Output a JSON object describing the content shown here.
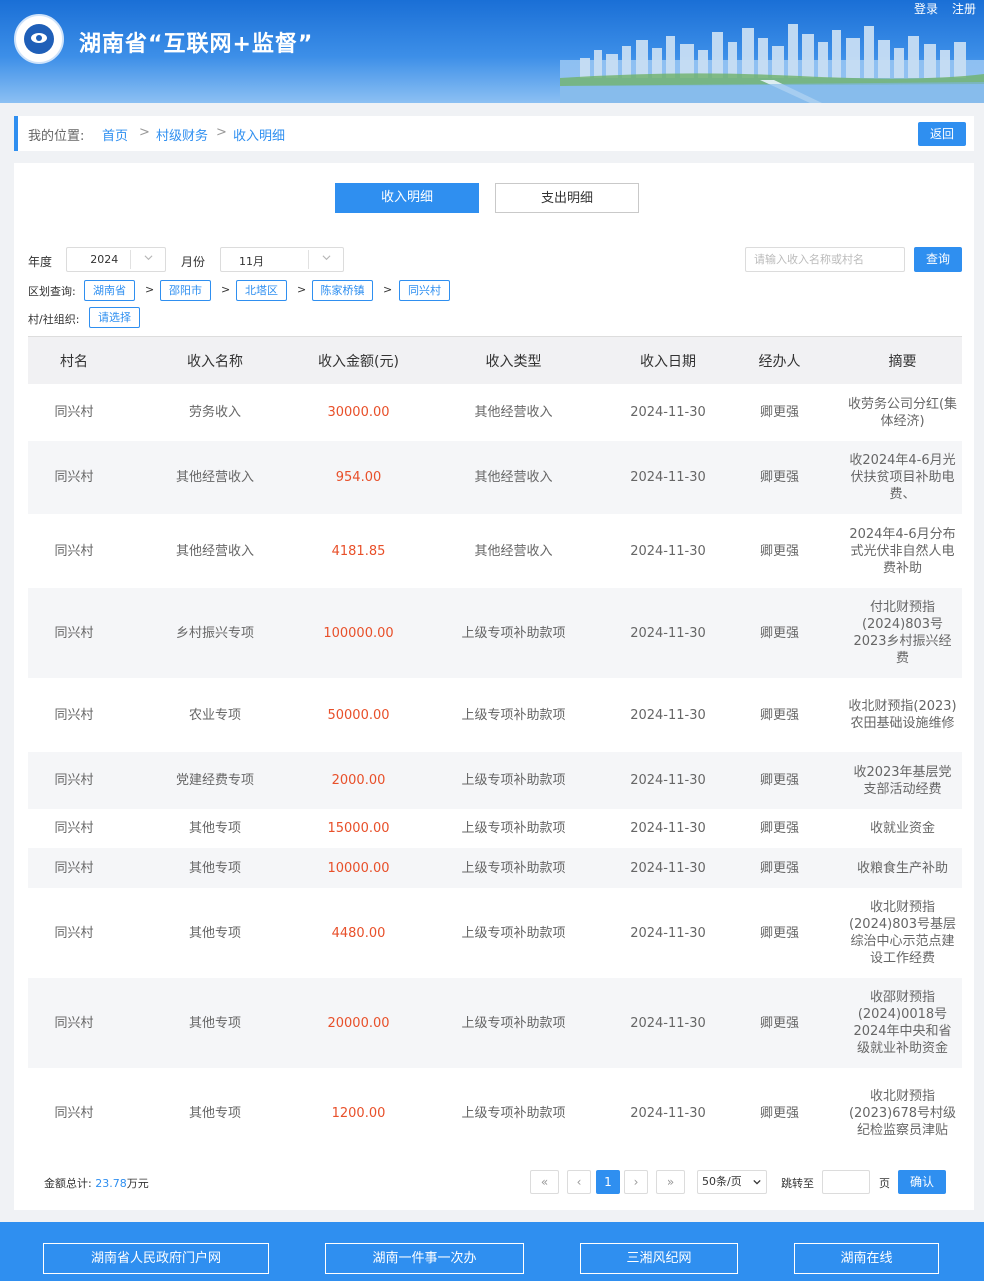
{
  "header": {
    "title": "湖南省“互联网+监督”",
    "login": "登录",
    "register": "注册"
  },
  "breadcrumb": {
    "prefix": "我的位置:",
    "items": [
      "首页",
      "村级财务",
      "收入明细"
    ],
    "separator": ">",
    "back": "返回"
  },
  "tabs": [
    "收入明细",
    "支出明细"
  ],
  "filters": {
    "year_label": "年度",
    "year_value": "2024",
    "month_label": "月份",
    "month_value": "11月",
    "search_placeholder": "请输入收入名称或村名",
    "query_label": "查询",
    "region_label": "区划查询:",
    "regions": [
      "湖南省",
      "邵阳市",
      "北塔区",
      "陈家桥镇",
      "同兴村"
    ],
    "village_label": "村/社组织:",
    "village_select": "请选择"
  },
  "table": {
    "headers": [
      "村名",
      "收入名称",
      "收入金额(元)",
      "收入类型",
      "收入日期",
      "经办人",
      "摘要"
    ],
    "rows": [
      [
        "同兴村",
        "劳务收入",
        "30000.00",
        "其他经营收入",
        "2024-11-30",
        "卿更强",
        "收劳务公司分红(集体经济)"
      ],
      [
        "同兴村",
        "其他经营收入",
        "954.00",
        "其他经营收入",
        "2024-11-30",
        "卿更强",
        "收2024年4-6月光伏扶贫项目补助电费、"
      ],
      [
        "同兴村",
        "其他经营收入",
        "4181.85",
        "其他经营收入",
        "2024-11-30",
        "卿更强",
        "2024年4-6月分布式光伏非自然人电费补助"
      ],
      [
        "同兴村",
        "乡村振兴专项",
        "100000.00",
        "上级专项补助款项",
        "2024-11-30",
        "卿更强",
        "付北财预指(2024)803号2023乡村振兴经费"
      ],
      [
        "同兴村",
        "农业专项",
        "50000.00",
        "上级专项补助款项",
        "2024-11-30",
        "卿更强",
        "收北财预指(2023)农田基础设施维修"
      ],
      [
        "同兴村",
        "党建经费专项",
        "2000.00",
        "上级专项补助款项",
        "2024-11-30",
        "卿更强",
        "收2023年基层党支部活动经费"
      ],
      [
        "同兴村",
        "其他专项",
        "15000.00",
        "上级专项补助款项",
        "2024-11-30",
        "卿更强",
        "收就业资金"
      ],
      [
        "同兴村",
        "其他专项",
        "10000.00",
        "上级专项补助款项",
        "2024-11-30",
        "卿更强",
        "收粮食生产补助"
      ],
      [
        "同兴村",
        "其他专项",
        "4480.00",
        "上级专项补助款项",
        "2024-11-30",
        "卿更强",
        "收北财预指(2024)803号基层综治中心示范点建设工作经费"
      ],
      [
        "同兴村",
        "其他专项",
        "20000.00",
        "上级专项补助款项",
        "2024-11-30",
        "卿更强",
        "收邵财预指(2024)0018号2024年中央和省级就业补助资金"
      ],
      [
        "同兴村",
        "其他专项",
        "1200.00",
        "上级专项补助款项",
        "2024-11-30",
        "卿更强",
        "收北财预指(2023)678号村级纪检监察员津贴"
      ]
    ]
  },
  "summary": {
    "label": "金额总计:",
    "value": "23.78",
    "unit": "万元"
  },
  "pagination": {
    "first": "«",
    "prev": "‹",
    "current": "1",
    "next": "›",
    "last": "»",
    "page_size": "50条/页",
    "jump_label": "跳转至",
    "page_label": "页",
    "confirm": "确认"
  },
  "footer_links": [
    "湖南省人民政府门户网",
    "湖南一件事一次办",
    "三湘风纪网",
    "湖南在线"
  ],
  "colors": {
    "accent": "#2f8ff0",
    "amount": "#e8502a"
  }
}
